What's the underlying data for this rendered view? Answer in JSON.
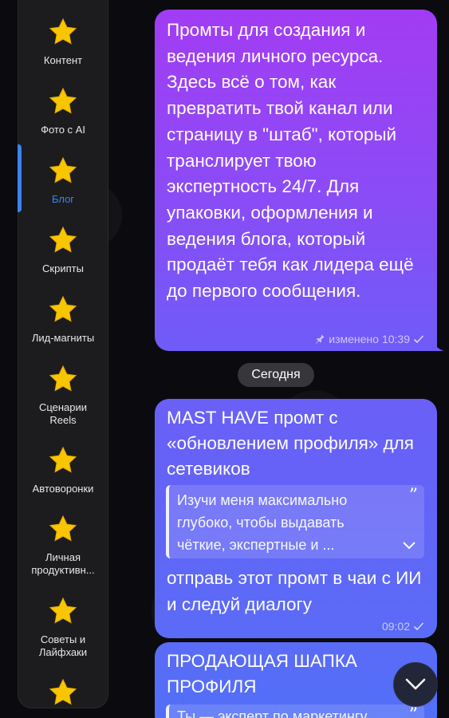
{
  "sidebar": {
    "items": [
      {
        "label": "Контент",
        "icon": "star-icon",
        "active": false
      },
      {
        "label": "Фото с AI",
        "icon": "star-icon",
        "active": false
      },
      {
        "label": "Блог",
        "icon": "star-icon",
        "active": true
      },
      {
        "label": "Скрипты",
        "icon": "star-icon",
        "active": false
      },
      {
        "label": "Лид-магниты",
        "icon": "star-icon",
        "active": false
      },
      {
        "label": "Сценарии Reels",
        "icon": "star-icon",
        "active": false
      },
      {
        "label": "Автоворонки",
        "icon": "star-icon",
        "active": false
      },
      {
        "label": "Личная продуктивн...",
        "icon": "star-icon",
        "active": false
      },
      {
        "label": "Советы и Лайфхаки",
        "icon": "star-icon",
        "active": false
      },
      {
        "label": "",
        "icon": "star-icon",
        "active": false
      }
    ],
    "active_color": "#3b82f6"
  },
  "messages": [
    {
      "text": "Промты для создания и ведения личного ресурса. Здесь всё о том, как превратить твой канал или страницу в \"штаб\", который транслирует твою экспертность 24/7. Для упаковки, оформления и ведения блога, который продаёт тебя как лидера ещё до первого сообщения.",
      "edited_label": "изменено",
      "time": "10:39"
    },
    {
      "title": "MAST HAVE промт с «обновлением профиля» для сетевиков",
      "quote": "Изучи меня максимально глубоко, чтобы выдавать чёткие, экспертные и ...",
      "body": "отправь этот промт в чаи с ИИ и следуй диалогу",
      "time": "09:02"
    },
    {
      "title": "ПРОДАЮЩАЯ ШАПКА ПРОФИЛЯ",
      "quote": "Ты — эксперт по маркетингу"
    }
  ],
  "date_separator": "Сегодня",
  "colors": {
    "bubble_purple": "#a23cf4",
    "bubble_blue": "#5a6bf7",
    "background": "#0b0b0f"
  }
}
